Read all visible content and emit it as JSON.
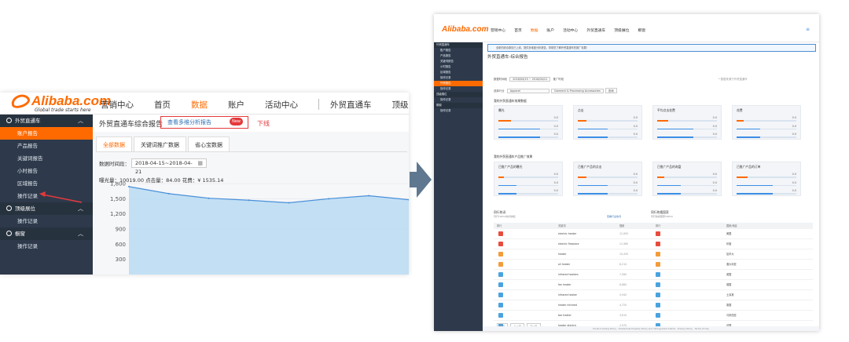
{
  "left": {
    "logo": {
      "word": "Alibaba.com",
      "tagline": "Global trade starts here"
    },
    "nav": [
      "营销中心",
      "首页",
      "数据",
      "账户",
      "活动中心",
      "外贸直通车",
      "顶级展位",
      "橱窗"
    ],
    "nav_active_index": 2,
    "sidebar": {
      "groups": [
        {
          "label": "外贸直通车",
          "items": [
            "账户报告",
            "产品报告",
            "关键词报告",
            "小时报告",
            "区域报告",
            "操作记录"
          ]
        },
        {
          "label": "顶级展位",
          "items": [
            "操作记录"
          ]
        },
        {
          "label": "橱窗",
          "items": [
            "操作记录"
          ]
        }
      ],
      "active_item": "账户报告"
    },
    "page_title": "外贸直通车综合报告",
    "link_label": "查看多维分析报告",
    "new_badge": "New",
    "offline_note": "下线",
    "tabs": [
      "全部数据",
      "关键词推广数据",
      "省心宝数据"
    ],
    "active_tab": 0,
    "date_label": "数据时间段：",
    "date_range": "2018-04-15~2018-04-21",
    "stats_text": "曝光量：10019.00 点击量：84.00 花费：¥ 1535.14"
  },
  "chart_data": {
    "type": "area",
    "yticks": [
      "1,800",
      "1,500",
      "1,200",
      "900",
      "600",
      "300"
    ],
    "ylim": [
      0,
      1800
    ],
    "values": [
      1740,
      1600,
      1510,
      1470,
      1420,
      1500,
      1560,
      1480
    ],
    "fill": "#b9dbf3",
    "line": "#4a90d9"
  },
  "right": {
    "logo": "Alibaba.com",
    "nav": [
      "营销中心",
      "首页",
      "数据",
      "账户",
      "活动中心",
      "外贸直通车",
      "顶级展位",
      "橱窗"
    ],
    "nav_active_index": 2,
    "sidebar": [
      "外贸直通车",
      "账户报告",
      "产品报告",
      "关键词报告",
      "小时报告",
      "区域报告",
      "操作记录",
      "外贸报告",
      "操作记录",
      "顶级展位",
      "操作记录",
      "橱窗",
      "操作记录"
    ],
    "sidebar_active": "外贸报告",
    "notice": "全新的综合报告已上线，提供多维度分析报告，帮助您了解外贸直通车的推广效果！",
    "title": "外贸直通车-综合报告",
    "filter1_label": "数据时间段",
    "filter1_value": "2018/04/15 ~ 2018/04/21",
    "filter1_extra": "推广时段",
    "filter2_label": "选择行业",
    "filter2_value": "Apparel",
    "filter2_value2": "Garment & Processing Accessories",
    "filter2_btn": "查询",
    "note_right": "* 数据来源于外贸直通车",
    "section1": "我的外贸直通车效果数据",
    "cards1": [
      {
        "title": "曝光",
        "v": "0.0",
        "bar": 0.7
      },
      {
        "title": "点击",
        "v": "0.0",
        "bar": 0.5
      },
      {
        "title": "平均点击花费",
        "v": "0.0",
        "bar": 0.6
      },
      {
        "title": "花费",
        "v": "0.0",
        "bar": 0.4
      }
    ],
    "section2": "我的外贸直通车产品推广效果",
    "cards2": [
      {
        "title": "已推广产品的曝光",
        "v": "0.0",
        "bar": 0.3
      },
      {
        "title": "已推广产品的点击",
        "v": "0.0",
        "bar": 0.5
      },
      {
        "title": "已推广产品的询盘",
        "v": "0.0",
        "bar": 0.4
      },
      {
        "title": "已推广产品的订单",
        "v": "0.0",
        "bar": 0.6
      }
    ],
    "kw_title": "同行热词",
    "kw_sub": "同行TOP10热词排名",
    "kw_link": "查看行业热词",
    "kw_title2": "同行热搜国家",
    "kw_sub2": "同行热搜国家TOP10",
    "table_headers": [
      "排行",
      "关键词",
      "搜索",
      "排行",
      "国家/地区"
    ],
    "rows": [
      {
        "k": "electric heater",
        "s": "12,650",
        "c": "美国",
        "color": "#e84c3d"
      },
      {
        "k": "electric fireplace",
        "s": "11,980",
        "c": "印度",
        "color": "#e84c3d"
      },
      {
        "k": "heater",
        "s": "10,430",
        "c": "加拿大",
        "color": "#f39c3c"
      },
      {
        "k": "oil heater",
        "s": "8,210",
        "c": "澳大利亚",
        "color": "#f39c3c"
      },
      {
        "k": "infrared heaters",
        "s": "7,560",
        "c": "英国",
        "color": "#4aa3df"
      },
      {
        "k": "fan heater",
        "s": "6,880",
        "c": "德国",
        "color": "#4aa3df"
      },
      {
        "k": "infrared heater",
        "s": "5,940",
        "c": "土耳其",
        "color": "#4aa3df"
      },
      {
        "k": "heater infrared",
        "s": "4,720",
        "c": "泰国",
        "color": "#4aa3df"
      },
      {
        "k": "bar heater",
        "s": "3,810",
        "c": "马来西亚",
        "color": "#4aa3df"
      },
      {
        "k": "heater electric",
        "s": "2,970",
        "c": "法国",
        "color": "#4aa3df"
      }
    ],
    "pager": [
      "首页",
      "上一页",
      "下一页"
    ],
    "footer": "Product Listing Policy · Intellectual Property Policy and Infringement Claims · Privacy Policy · Terms of Use"
  }
}
